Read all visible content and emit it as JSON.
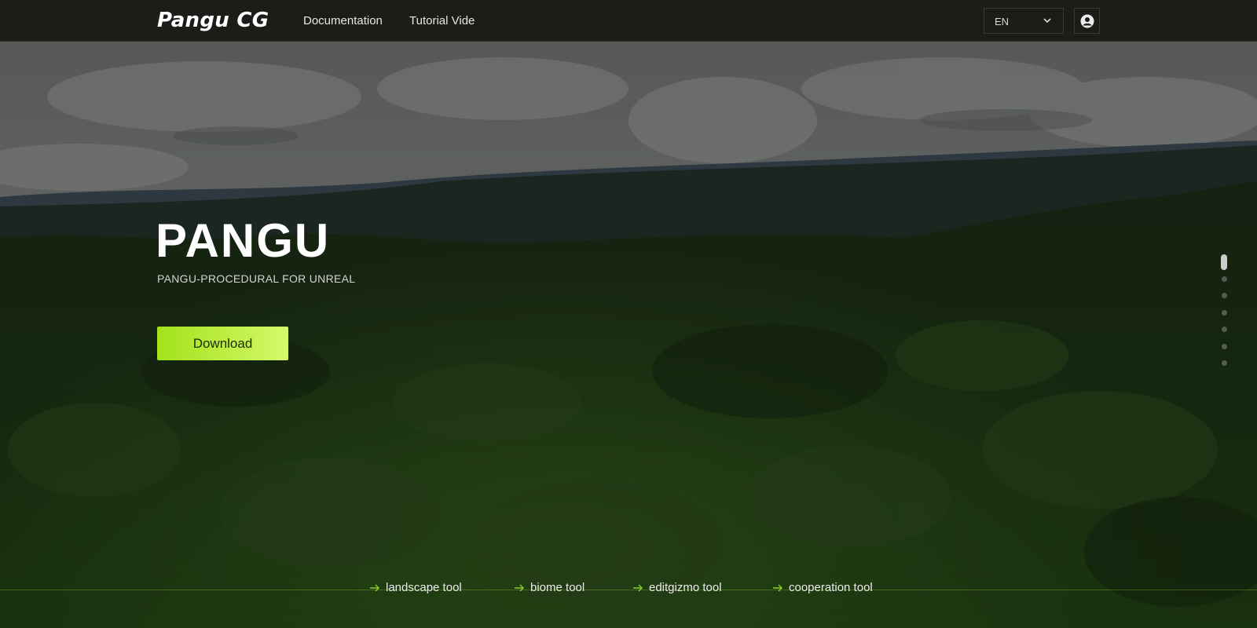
{
  "nav": {
    "logo": "Pangu CG",
    "links": [
      "Documentation",
      "Tutorial Vide"
    ],
    "language": "EN"
  },
  "hero": {
    "title": "PANGU",
    "subtitle": "PANGU-PROCEDURAL FOR UNREAL",
    "download_label": "Download",
    "slide_count": 7,
    "active_slide": 1
  },
  "tools": [
    "landscape tool",
    "biome tool",
    "editgizmo tool",
    "cooperation tool"
  ],
  "colors": {
    "navbar": "#1c1d18",
    "accent_start": "#a2e21a",
    "accent_end": "#d4f96a",
    "arrow": "#8ccf2a"
  },
  "icons": {
    "language_dropdown": "chevron-down-icon",
    "user": "user-circle-icon",
    "tool_arrow": "arrow-right-icon"
  }
}
